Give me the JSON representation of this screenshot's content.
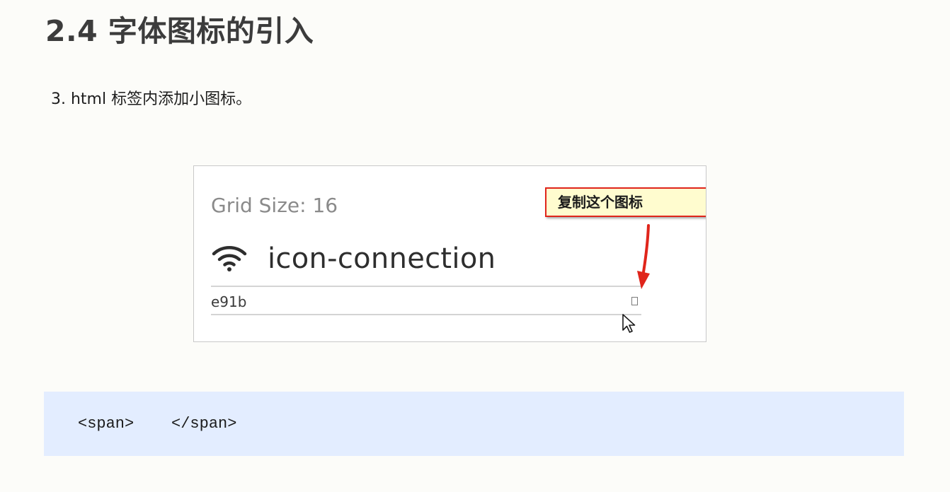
{
  "heading": {
    "title": "2.4 字体图标的引入"
  },
  "instruction": {
    "step": "3. html 标签内添加小图标。"
  },
  "icon_preview": {
    "grid_size_label": "Grid Size: 16",
    "icon_name": "icon-connection",
    "icon_symbol": "wifi-icon",
    "unicode_value": "e91b",
    "glyph_placeholder": "missing-glyph-box",
    "callout_text": "复制这个图标",
    "callout_border_color": "#e0251b",
    "callout_background_color": "#fffccf"
  },
  "code_block": {
    "code": "<span>    </span>",
    "background_color": "#e3edff"
  }
}
